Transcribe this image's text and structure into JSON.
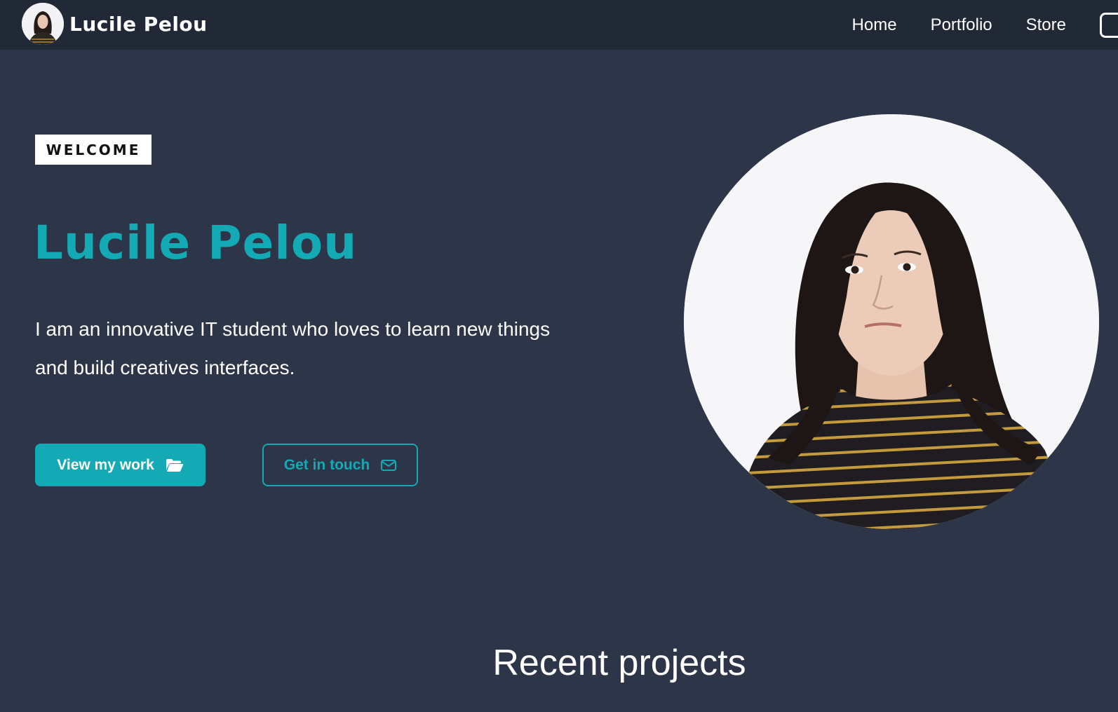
{
  "navbar": {
    "brand_name": "Lucile Pelou",
    "links": [
      "Home",
      "Portfolio",
      "Store"
    ]
  },
  "hero": {
    "welcome": "WELCOME",
    "title": "Lucile Pelou",
    "intro": "I am an innovative IT student who loves to learn new things and build creatives interfaces.",
    "primary_button": "View my work",
    "primary_button_icon": "folder-open-icon",
    "secondary_button": "Get in touch",
    "secondary_button_icon": "envelope-icon"
  },
  "section": {
    "recent_projects_title": "Recent projects"
  },
  "colors": {
    "background": "#2d3548",
    "navbar": "#212836",
    "accent": "#13a9b5",
    "text": "#ffffff"
  }
}
